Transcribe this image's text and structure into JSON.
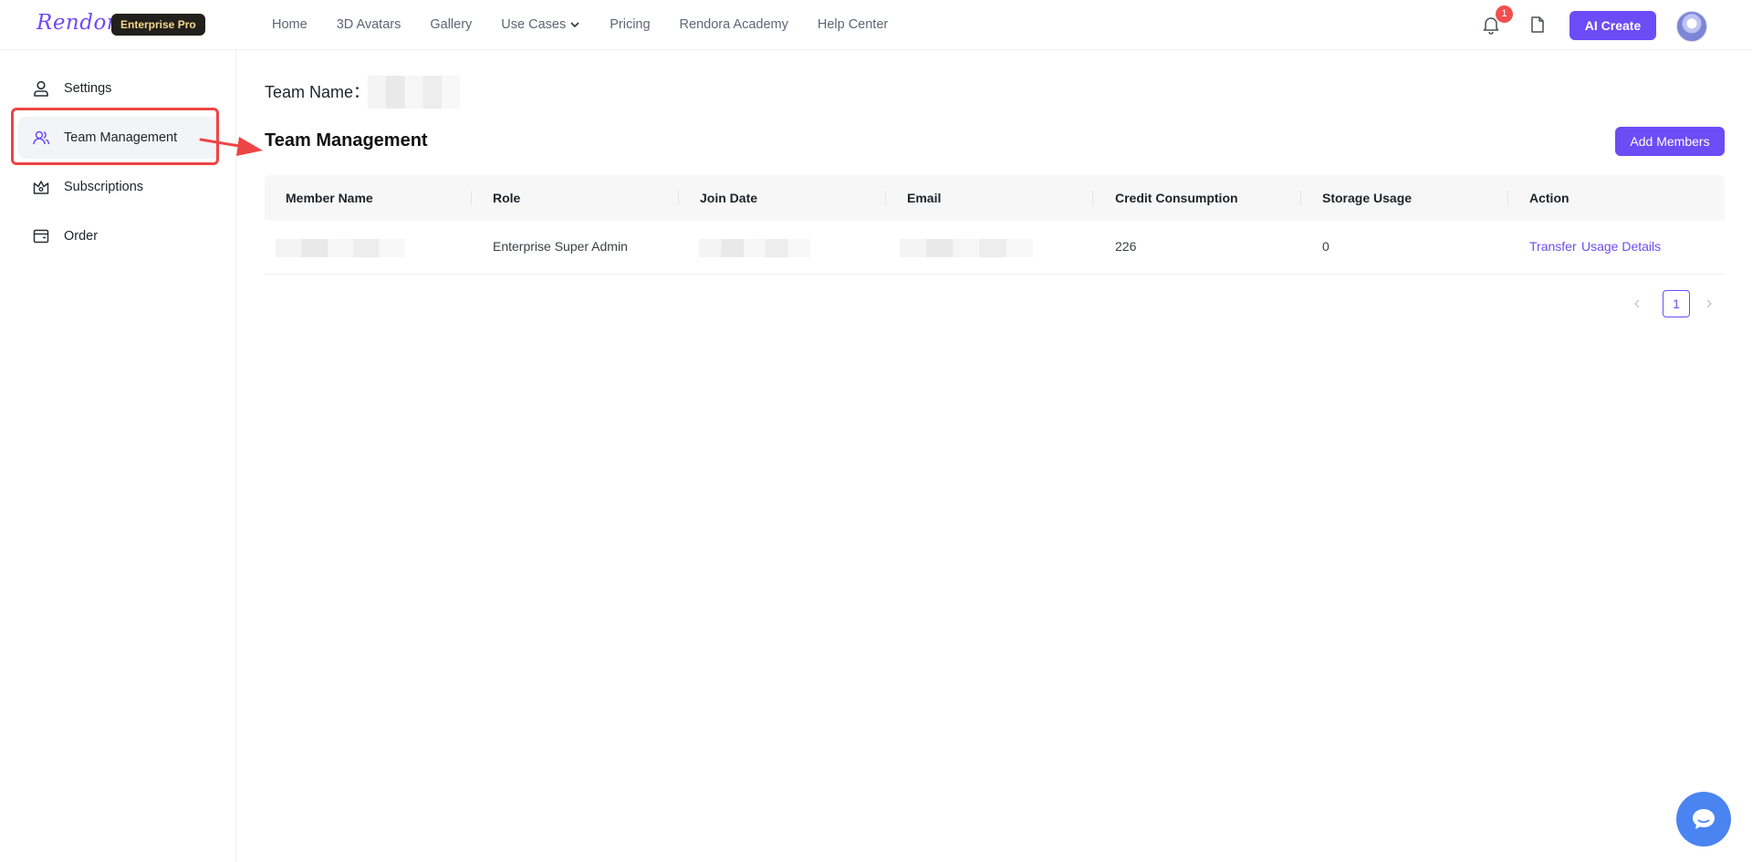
{
  "header": {
    "logo": "Rendora",
    "plan_badge": "Enterprise Pro",
    "nav": [
      "Home",
      "3D Avatars",
      "Gallery",
      "Use Cases",
      "Pricing",
      "Rendora Academy",
      "Help Center"
    ],
    "notification_count": "1",
    "ai_create_label": "AI Create",
    "icons": [
      "bell-icon",
      "document-icon",
      "chevron-down-icon"
    ]
  },
  "sidebar": {
    "items": [
      {
        "label": "Settings",
        "icon": "user-icon"
      },
      {
        "label": "Team Management",
        "icon": "team-icon",
        "active": true
      },
      {
        "label": "Subscriptions",
        "icon": "crown-icon"
      },
      {
        "label": "Order",
        "icon": "wallet-icon"
      }
    ]
  },
  "main": {
    "team_name_label": "Team Name：",
    "title": "Team Management",
    "add_members_label": "Add Members",
    "table": {
      "columns": [
        "Member Name",
        "Role",
        "Join Date",
        "Email",
        "Credit Consumption",
        "Storage Usage",
        "Action"
      ],
      "rows": [
        {
          "member_name": "",
          "role": "Enterprise Super Admin",
          "join_date": "",
          "email": "",
          "credit_consumption": "226",
          "storage_usage": "0",
          "actions": [
            "Transfer",
            "Usage Details"
          ]
        }
      ]
    },
    "pagination": {
      "current_page": "1"
    }
  },
  "colors": {
    "accent": "#6c4cf5",
    "highlight": "#ee4445",
    "chat": "#4a84f0"
  }
}
